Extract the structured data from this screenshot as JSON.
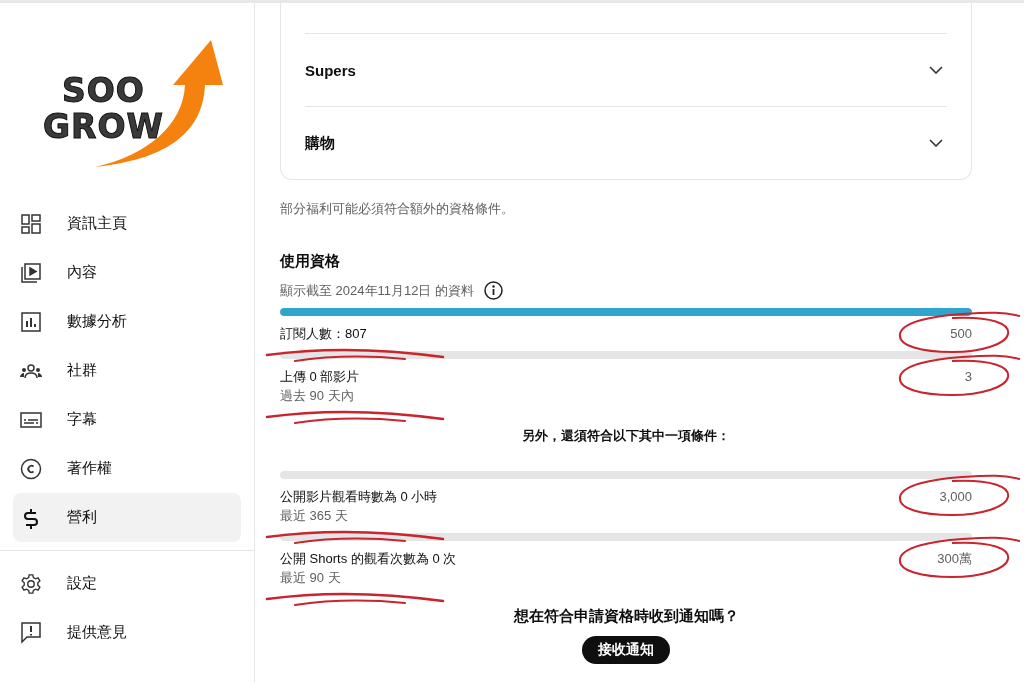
{
  "logo": {
    "lines": [
      "SOO",
      "GROW"
    ]
  },
  "sidebar": {
    "items": [
      {
        "label": "資訊主頁",
        "selected": false
      },
      {
        "label": "內容",
        "selected": false
      },
      {
        "label": "數據分析",
        "selected": false
      },
      {
        "label": "社群",
        "selected": false
      },
      {
        "label": "字幕",
        "selected": false
      },
      {
        "label": "著作權",
        "selected": false
      },
      {
        "label": "營利",
        "selected": true
      }
    ],
    "footer_items": [
      {
        "label": "設定"
      },
      {
        "label": "提供意見"
      }
    ]
  },
  "benefits": {
    "rows": [
      {
        "label": "Supers",
        "expanded": false
      },
      {
        "label": "購物",
        "expanded": false
      }
    ],
    "note": "部分福利可能必須符合額外的資格條件。"
  },
  "eligibility": {
    "title": "使用資格",
    "date_note": "顯示截至 2024年11月12日 的資料",
    "requirements": [
      {
        "label": "訂閱人數：807",
        "target": "500",
        "level": 1,
        "circled": true,
        "underlined": true
      },
      {
        "label": "上傳 0 部影片",
        "sublabel": "過去 90 天內",
        "target": "3",
        "level": 0,
        "circled": true,
        "underlined": true
      }
    ],
    "alternative_heading": "另外，還須符合以下其中一項條件：",
    "alternatives": [
      {
        "label": "公開影片觀看時數為 0 小時",
        "sublabel": "最近 365 天",
        "target": "3,000",
        "level": 0,
        "circled": true,
        "underlined": true
      },
      {
        "label": "公開 Shorts 的觀看次數為 0 次",
        "sublabel": "最近 90 天",
        "target": "300萬",
        "level": 0,
        "circled": true,
        "underlined": true
      }
    ],
    "notify_question": "想在符合申請資格時收到通知嗎？",
    "notify_button": "接收通知"
  }
}
